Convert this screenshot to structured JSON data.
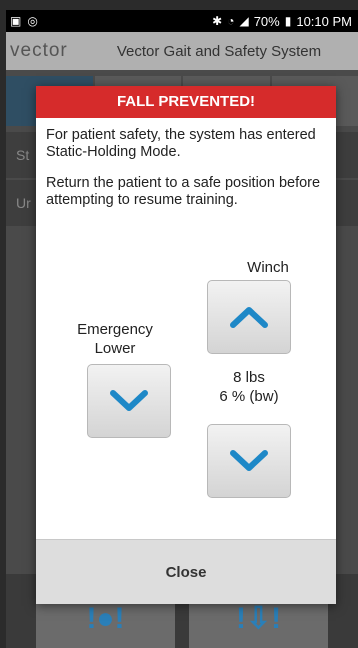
{
  "status_bar": {
    "battery": "70%",
    "time": "10:10 PM"
  },
  "header": {
    "logo_text": "vector",
    "title": "Vector Gait and Safety System"
  },
  "background": {
    "row1_text": "St",
    "row2_text": "Ur"
  },
  "dialog": {
    "title": "FALL PREVENTED!",
    "message1": "For patient safety, the system has entered Static-Holding Mode.",
    "message2": "Return the patient to a safe position before attempting to resume training.",
    "emergency_lower_label": "Emergency Lower",
    "winch_label": "Winch",
    "weight_lbs": "8 lbs",
    "weight_bw": "6 % (bw)",
    "close_label": "Close",
    "title_color": "#d62b2b",
    "arrow_color": "#1e88c7"
  }
}
